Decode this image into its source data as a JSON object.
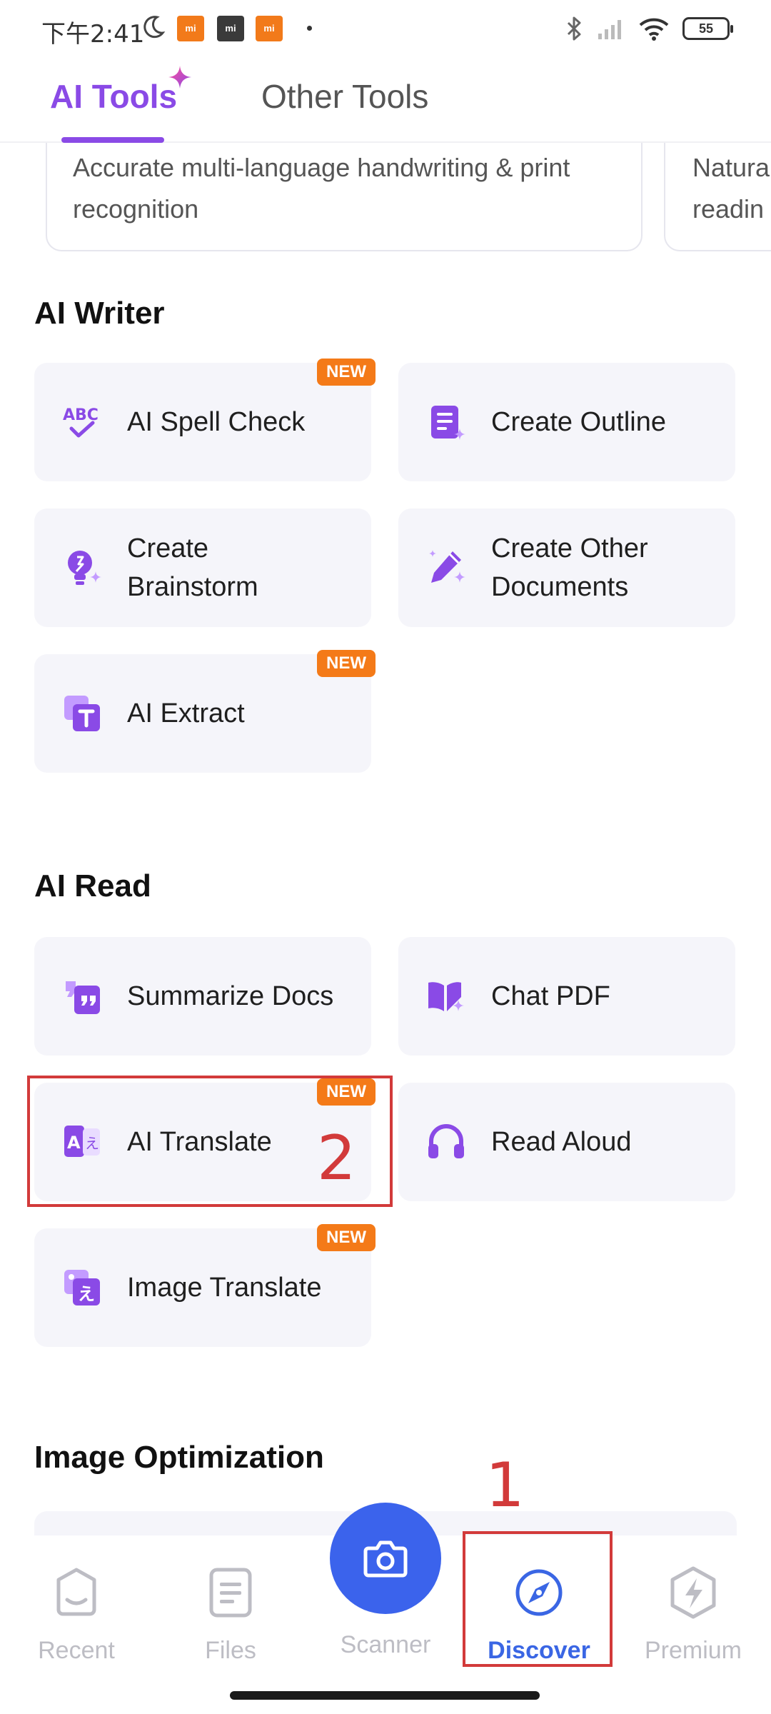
{
  "status_bar": {
    "time": "下午2:41",
    "battery": "55"
  },
  "tabs": [
    {
      "label": "AI Tools",
      "active": true
    },
    {
      "label": "Other Tools",
      "active": false
    }
  ],
  "top_cards": [
    {
      "line1": "Accurate multi-language handwriting & print",
      "line2": "recognition"
    },
    {
      "line1": "Natura",
      "line2": "readin"
    }
  ],
  "ai_writer": {
    "title": "AI Writer",
    "items": [
      {
        "label": "AI Spell Check",
        "icon": "abc-check-icon",
        "badge": "NEW"
      },
      {
        "label": "Create Outline",
        "icon": "outline-icon",
        "badge": ""
      },
      {
        "label": "Create Brainstorm",
        "icon": "lightbulb-icon",
        "badge": ""
      },
      {
        "label": "Create Other Documents",
        "icon": "pen-sparkle-icon",
        "badge": ""
      },
      {
        "label": "AI Extract",
        "icon": "extract-text-icon",
        "badge": "NEW"
      }
    ]
  },
  "ai_read": {
    "title": "AI Read",
    "items": [
      {
        "label": "Summarize Docs",
        "icon": "quote-icon",
        "badge": ""
      },
      {
        "label": "Chat PDF",
        "icon": "book-sparkle-icon",
        "badge": ""
      },
      {
        "label": "AI Translate",
        "icon": "translate-icon",
        "badge": "NEW"
      },
      {
        "label": "Read Aloud",
        "icon": "headphones-icon",
        "badge": ""
      },
      {
        "label": "Image Translate",
        "icon": "image-translate-icon",
        "badge": "NEW"
      }
    ]
  },
  "image_optimization": {
    "title": "Image Optimization"
  },
  "annotations": {
    "first": "1",
    "second": "2"
  },
  "bottom_nav": {
    "items": [
      {
        "label": "Recent",
        "icon": "recent-icon",
        "active": false
      },
      {
        "label": "Files",
        "icon": "files-icon",
        "active": false
      },
      {
        "label": "Scanner",
        "icon": "camera-icon",
        "active": false
      },
      {
        "label": "Discover",
        "icon": "compass-icon",
        "active": true
      },
      {
        "label": "Premium",
        "icon": "lightning-icon",
        "active": false
      }
    ]
  },
  "colors": {
    "accent_purple": "#8a4ae6",
    "badge_orange": "#f47a18",
    "nav_active_blue": "#3a66e4",
    "scanner_blue": "#3b63ec",
    "annotation_red": "#d23a3a"
  }
}
